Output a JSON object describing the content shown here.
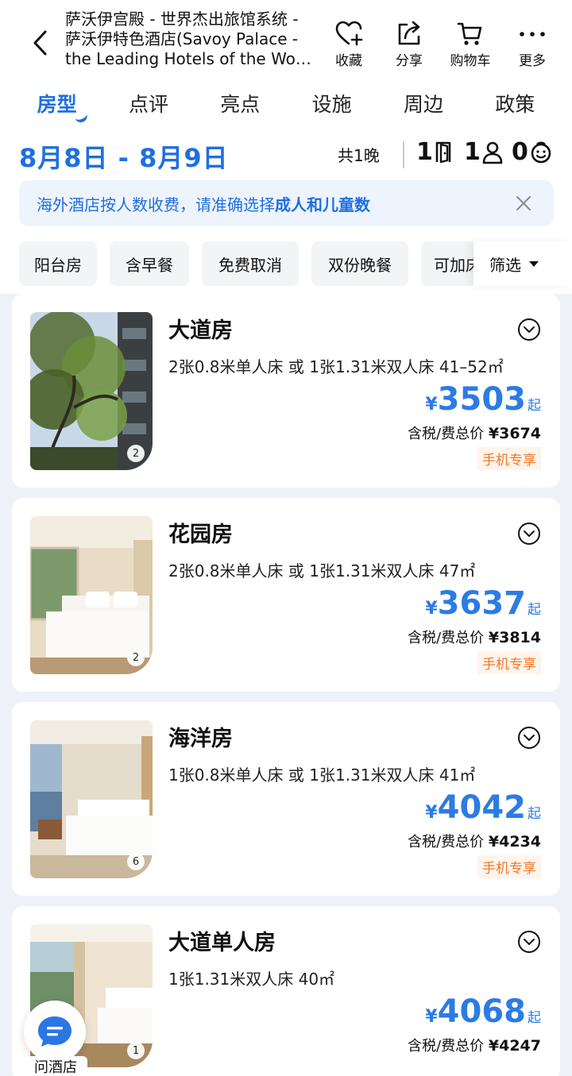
{
  "header": {
    "title_lines": [
      "萨沃伊宫殿 - 世界杰出旅馆系统 -",
      "萨沃伊特色酒店(Savoy Palace -",
      "the Leading Hotels of the Worl..."
    ],
    "actions": [
      {
        "label": "收藏",
        "icon": "heart-plus-icon"
      },
      {
        "label": "分享",
        "icon": "share-icon"
      },
      {
        "label": "购物车",
        "icon": "cart-icon"
      },
      {
        "label": "更多",
        "icon": "more-icon"
      }
    ]
  },
  "tabs": [
    {
      "label": "房型",
      "active": true
    },
    {
      "label": "点评",
      "active": false
    },
    {
      "label": "亮点",
      "active": false
    },
    {
      "label": "设施",
      "active": false
    },
    {
      "label": "周边",
      "active": false
    },
    {
      "label": "政策",
      "active": false
    }
  ],
  "booking": {
    "date_range": "8月8日 - 8月9日",
    "nights": "共1晚",
    "rooms": "1",
    "adults": "1",
    "children": "0"
  },
  "notice": {
    "text_plain": "海外酒店按人数收费，请准确选择",
    "text_bold": "成人和儿童数"
  },
  "filters": {
    "chips": [
      "阳台房",
      "含早餐",
      "免费取消",
      "双份晚餐",
      "可加床"
    ],
    "button_label": "筛选"
  },
  "rooms": [
    {
      "name": "大道房",
      "beds": "2张0.8米单人床 或 1张1.31米双人床  41–52㎡",
      "currency": "¥",
      "price": "3503",
      "price_suffix": "起",
      "total_label": "含税/费总价",
      "total_amount": "¥3674",
      "tag": "手机专享",
      "image_count": "2",
      "image_kind": "trees"
    },
    {
      "name": "花园房",
      "beds": "2张0.8米单人床 或 1张1.31米双人床  47㎡",
      "currency": "¥",
      "price": "3637",
      "price_suffix": "起",
      "total_label": "含税/费总价",
      "total_amount": "¥3814",
      "tag": "手机专享",
      "image_count": "2",
      "image_kind": "bedroom-warm"
    },
    {
      "name": "海洋房",
      "beds": "1张0.8米单人床 或 1张1.31米双人床  41㎡",
      "currency": "¥",
      "price": "4042",
      "price_suffix": "起",
      "total_label": "含税/费总价",
      "total_amount": "¥4234",
      "tag": "手机专享",
      "image_count": "6",
      "image_kind": "bedroom-sea"
    },
    {
      "name": "大道单人房",
      "beds": "1张1.31米双人床  40㎡",
      "currency": "¥",
      "price": "4068",
      "price_suffix": "起",
      "total_label": "含税/费总价",
      "total_amount": "¥4247",
      "tag": "",
      "image_count": "1",
      "image_kind": "bedroom-window"
    }
  ],
  "chat": {
    "label": "问酒店",
    "icon": "chat-bubble-icon"
  },
  "colors": {
    "accent": "#1f6fe0",
    "price": "#2c7be5",
    "tag": "#f07a2a",
    "list_bg": "#eef2f8"
  }
}
